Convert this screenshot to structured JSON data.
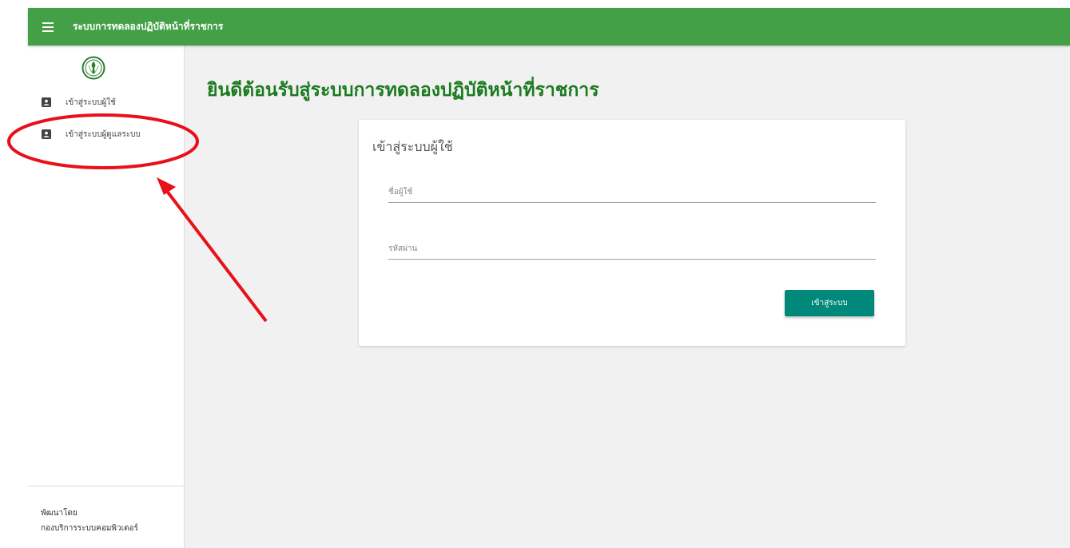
{
  "header": {
    "title": "ระบบการทดลองปฏิบัติหน้าที่ราชการ",
    "menu_icon": "hamburger-menu-icon",
    "color": "#43a047"
  },
  "sidebar": {
    "logo_icon": "emblem-logo-icon",
    "items": [
      {
        "label": "เข้าสู่ระบบผู้ใช้",
        "icon": "account-box-icon"
      },
      {
        "label": "เข้าสู่ระบบผู้ดูแลระบบ",
        "icon": "account-box-icon"
      }
    ],
    "footer": {
      "line1": "พัฒนาโดย",
      "line2": "กองบริการระบบคอมพิวเตอร์"
    }
  },
  "main": {
    "welcome": "ยินดีต้อนรับสู่ระบบการทดลองปฏิบัติหน้าที่ราชการ",
    "welcome_color": "#1b7a1f",
    "login_card": {
      "title": "เข้าสู่ระบบผู้ใช้",
      "username_placeholder": "ชื่อผู้ใช้",
      "password_placeholder": "รหัสผ่าน",
      "submit_label": "เข้าสู่ระบบ",
      "submit_color": "#00897b"
    }
  },
  "annotation": {
    "color": "#e8101a",
    "shapes": [
      "ellipse-highlight",
      "arrow-pointer"
    ]
  }
}
